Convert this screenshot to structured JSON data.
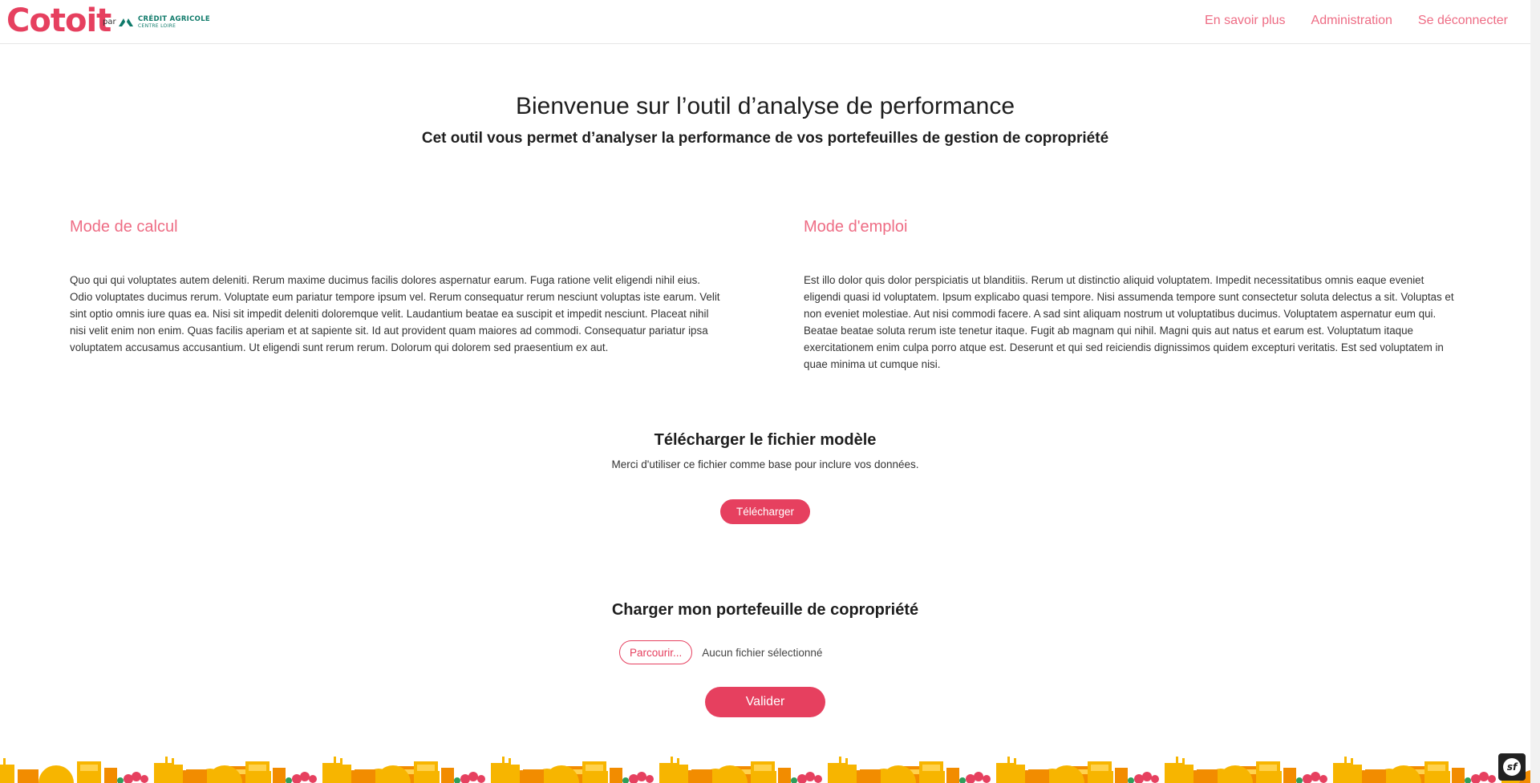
{
  "header": {
    "logo_text": "Cotoit",
    "par": "par",
    "partner_name": "CRÉDIT AGRICOLE",
    "partner_sub": "CENTRE LOIRE",
    "nav": [
      "En savoir plus",
      "Administration",
      "Se déconnecter"
    ]
  },
  "hero": {
    "title": "Bienvenue sur l’outil d’analyse de performance",
    "subtitle": "Cet outil vous permet d’analyser la performance de vos portefeuilles de gestion de copropriété"
  },
  "calcul": {
    "title": "Mode de calcul",
    "text": "Quo qui qui voluptates autem deleniti. Rerum maxime ducimus facilis dolores aspernatur earum. Fuga ratione velit eligendi nihil eius. Odio voluptates ducimus rerum. Voluptate eum pariatur tempore ipsum vel. Rerum consequatur rerum nesciunt voluptas iste earum. Velit sint optio omnis iure quas ea. Nisi sit impedit deleniti doloremque velit. Laudantium beatae ea suscipit et impedit nesciunt. Placeat nihil nisi velit enim non enim. Quas facilis aperiam et at sapiente sit. Id aut provident quam maiores ad commodi. Consequatur pariatur ipsa voluptatem accusamus accusantium. Ut eligendi sunt rerum rerum. Dolorum qui dolorem sed praesentium ex aut."
  },
  "emploi": {
    "title": "Mode d'emploi",
    "text": "Est illo dolor quis dolor perspiciatis ut blanditiis. Rerum ut distinctio aliquid voluptatem. Impedit necessitatibus omnis eaque eveniet eligendi quasi id voluptatem. Ipsum explicabo quasi tempore. Nisi assumenda tempore sunt consectetur soluta delectus a sit. Voluptas et non eveniet molestiae. Aut nisi commodi facere. A sad sint aliquam nostrum ut voluptatibus ducimus. Voluptatem aspernatur eum qui. Beatae beatae soluta rerum iste tenetur itaque. Fugit ab magnam qui nihil. Magni quis aut natus et earum est. Voluptatum itaque exercitationem enim culpa porro atque est. Deserunt et qui sed reiciendis dignissimos quidem excepturi veritatis. Est sed voluptatem in quae minima ut cumque nisi."
  },
  "download": {
    "title": "Télécharger le fichier modèle",
    "text": "Merci d'utiliser ce fichier comme base pour inclure vos données.",
    "button": "Télécharger"
  },
  "upload": {
    "title": "Charger mon portefeuille de copropriété",
    "browse": "Parcourir...",
    "no_file": "Aucun fichier sélectionné",
    "submit": "Valider"
  },
  "colors": {
    "accent": "#e6405f",
    "link": "#ee6c84",
    "partner": "#0f7a6a",
    "deco_yellow": "#f7b500",
    "deco_orange": "#f28c00"
  }
}
